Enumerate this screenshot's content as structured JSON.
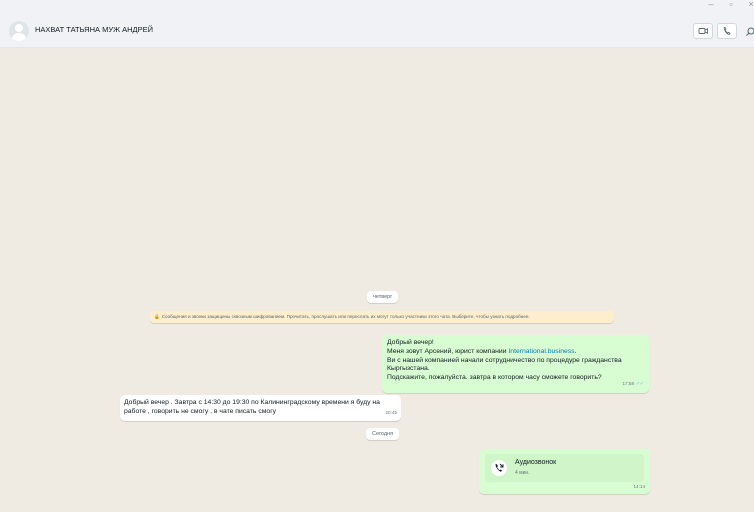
{
  "header": {
    "contact_name": "НАХВАТ ТАТЬЯНА МУЖ АНДРЕЙ"
  },
  "chat": {
    "day_label_1": "четверг",
    "system_message": "Сообщения и звонки защищены сквозным шифрованием. Прочитать, прослушать или переслать их могут только участники этого чата. Выберите, чтобы узнать подробнее.",
    "messages": [
      {
        "direction": "outgoing",
        "line1": "Добрый вечер!",
        "line2_prefix": "Меня зовут Арсений, юрист компании ",
        "link": "International.business",
        "line2_suffix": ".",
        "line3": "Ви с нашей компанией начали сотрудничество по процедуре гражданства",
        "line4": "Кыргызстана.",
        "line5": "Подскажите, пожалуйста. завтра в котором часу сможете говорить?",
        "time": "17:58",
        "ticks": "✓✓"
      },
      {
        "direction": "incoming",
        "line1": "Добрый вечер . Завтра с 14:30 до 19:30 по Калининградскому времени я буду на",
        "line2": "работе , говорить не смогу , в чате писать смогу",
        "time": "20:45"
      }
    ],
    "day_label_2": "Сегодня",
    "call": {
      "title": "Аудиозвонок",
      "duration": "4 мин.",
      "time": "14:14"
    }
  },
  "icons": {
    "video_call": "video-camera-icon",
    "voice_call": "phone-icon",
    "search": "search-icon",
    "lock": "lock-icon",
    "call_type": "incoming-call-icon"
  },
  "colors": {
    "chat_background": "#efeae2",
    "outgoing_bubble": "#d9fdd3",
    "incoming_bubble": "#ffffff",
    "system_message": "#ffeecd",
    "link": "#027eb5",
    "read_ticks": "#53bdeb"
  }
}
